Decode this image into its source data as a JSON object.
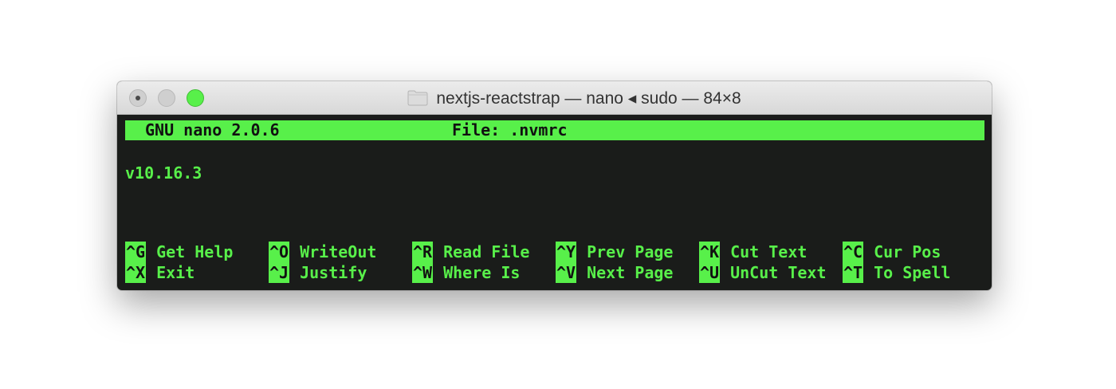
{
  "window": {
    "title": "nextjs-reactstrap — nano ◂ sudo — 84×8",
    "folder_icon": "folder-icon",
    "traffic_lights": [
      "close-button",
      "minimize-button",
      "zoom-button"
    ]
  },
  "nano": {
    "header_left": "GNU nano 2.0.6",
    "header_center": "File: .nvmrc",
    "content": "v10.16.3"
  },
  "shortcuts": {
    "row1": [
      {
        "key": "^G",
        "label": "Get Help"
      },
      {
        "key": "^O",
        "label": "WriteOut"
      },
      {
        "key": "^R",
        "label": "Read File"
      },
      {
        "key": "^Y",
        "label": "Prev Page"
      },
      {
        "key": "^K",
        "label": "Cut Text"
      },
      {
        "key": "^C",
        "label": "Cur Pos"
      }
    ],
    "row2": [
      {
        "key": "^X",
        "label": "Exit"
      },
      {
        "key": "^J",
        "label": "Justify"
      },
      {
        "key": "^W",
        "label": "Where Is"
      },
      {
        "key": "^V",
        "label": "Next Page"
      },
      {
        "key": "^U",
        "label": "UnCut Text"
      },
      {
        "key": "^T",
        "label": "To Spell"
      }
    ]
  },
  "colors": {
    "terminal_bg": "#1a1c1a",
    "accent_green": "#58f04a",
    "titlebar": "#e2e2e2"
  }
}
